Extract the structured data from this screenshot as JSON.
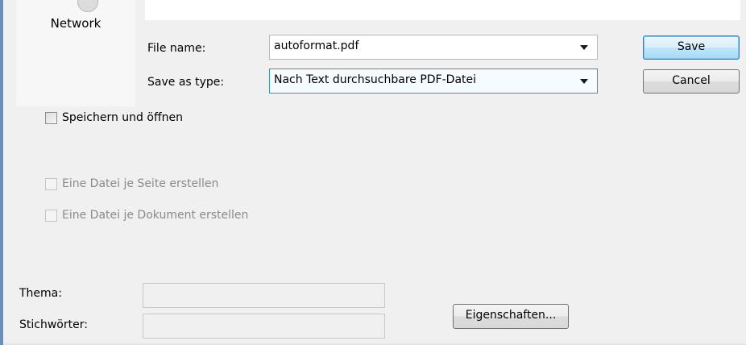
{
  "navigation": {
    "network_label": "Network"
  },
  "form": {
    "file_name_label": "File name:",
    "file_name_value": "autoformat.pdf",
    "save_as_type_label": "Save as type:",
    "save_as_type_value": "Nach Text durchsuchbare PDF-Datei"
  },
  "buttons": {
    "save": "Save",
    "cancel": "Cancel",
    "properties": "Eigenschaften..."
  },
  "options": {
    "save_and_open": "Speichern und öffnen",
    "one_file_per_page": "Eine Datei je Seite erstellen",
    "one_file_per_document": "Eine Datei je Dokument erstellen"
  },
  "metadata": {
    "subject_label": "Thema:",
    "subject_value": "",
    "keywords_label": "Stichwörter:",
    "keywords_value": ""
  }
}
